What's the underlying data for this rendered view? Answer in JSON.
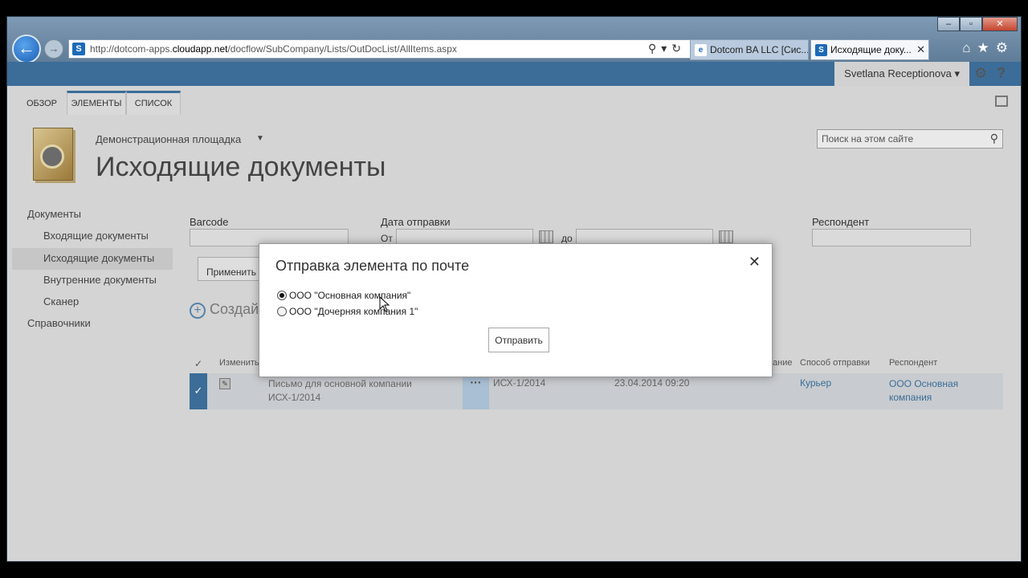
{
  "browser": {
    "address_url_prefix": "http://dotcom-apps.",
    "address_url_host": "cloudapp.net",
    "address_url_path": "/docflow/SubCompany/Lists/OutDocList/AllItems.aspx",
    "tabs": [
      {
        "label": "Dotcom BA LLC [Сис..."
      },
      {
        "label": "Исходящие доку..."
      }
    ],
    "icons": [
      "back-arrow-icon",
      "forward-arrow-icon",
      "sharepoint-favicon",
      "search-icon",
      "refresh-icon",
      "home-icon",
      "star-icon",
      "gear-icon",
      "close-icon"
    ]
  },
  "suitebar": {
    "user_name": "Svetlana Receptionova ▾",
    "accent": "#3b6d98"
  },
  "ribbon": {
    "tabs": [
      "ОБЗОР",
      "ЭЛЕМЕНТЫ",
      "СПИСОК"
    ]
  },
  "site": {
    "name": "Демонстрационная площадка",
    "page_title": "Исходящие документы",
    "search_placeholder": "Поиск на этом сайте"
  },
  "quicklaunch": {
    "items": [
      {
        "label": "Документы"
      },
      {
        "label": "Входящие документы"
      },
      {
        "label": "Исходящие документы"
      },
      {
        "label": "Внутренние документы"
      },
      {
        "label": "Сканер"
      },
      {
        "label": "Справочники"
      }
    ]
  },
  "filters": {
    "barcode_label": "Barcode",
    "date_label": "Дата отправки",
    "from_label": "От",
    "to_label": "до",
    "respondent_label": "Респондент",
    "apply_label": "Применить"
  },
  "list": {
    "new_label": "Создай",
    "columns": {
      "check": "✓",
      "edit": "Изменить",
      "name_tail": "ание",
      "method": "Способ отправки",
      "respondent": "Респондент"
    },
    "rows": [
      {
        "title": "Письмо для основной компании ИСХ-1/2014",
        "ellipsis": "···",
        "number": "ИСХ-1/2014",
        "date": "23.04.2014 09:20",
        "method": "Курьер",
        "respondent": "ООО Основная компания"
      }
    ]
  },
  "modal": {
    "title": "Отправка элемента по почте",
    "options": [
      {
        "label": "ООО \"Основная компания\"",
        "checked": true
      },
      {
        "label": "ООО \"Дочерняя компания 1\"",
        "checked": false
      }
    ],
    "send_label": "Отправить",
    "close_glyph": "✕"
  }
}
